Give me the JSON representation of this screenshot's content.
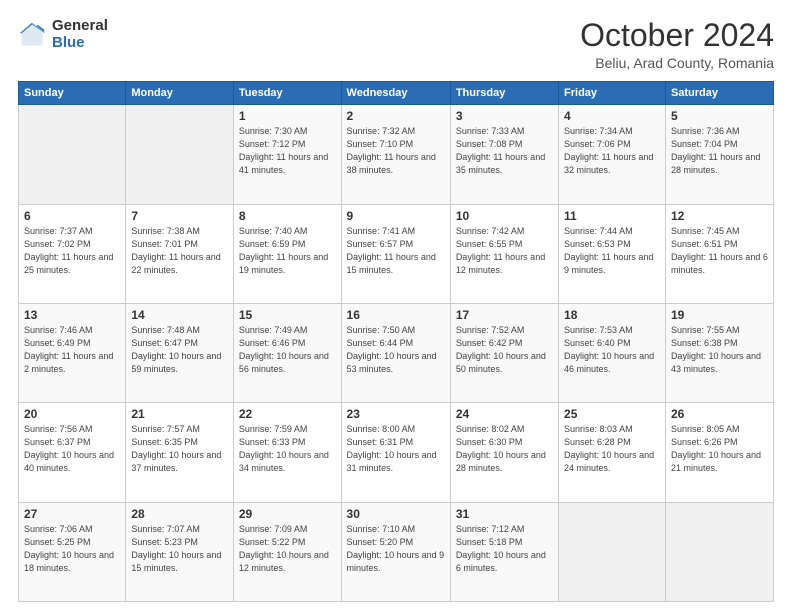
{
  "header": {
    "logo_general": "General",
    "logo_blue": "Blue",
    "title": "October 2024",
    "subtitle": "Beliu, Arad County, Romania"
  },
  "days_of_week": [
    "Sunday",
    "Monday",
    "Tuesday",
    "Wednesday",
    "Thursday",
    "Friday",
    "Saturday"
  ],
  "weeks": [
    [
      {
        "day": "",
        "info": ""
      },
      {
        "day": "",
        "info": ""
      },
      {
        "day": "1",
        "info": "Sunrise: 7:30 AM\nSunset: 7:12 PM\nDaylight: 11 hours and 41 minutes."
      },
      {
        "day": "2",
        "info": "Sunrise: 7:32 AM\nSunset: 7:10 PM\nDaylight: 11 hours and 38 minutes."
      },
      {
        "day": "3",
        "info": "Sunrise: 7:33 AM\nSunset: 7:08 PM\nDaylight: 11 hours and 35 minutes."
      },
      {
        "day": "4",
        "info": "Sunrise: 7:34 AM\nSunset: 7:06 PM\nDaylight: 11 hours and 32 minutes."
      },
      {
        "day": "5",
        "info": "Sunrise: 7:36 AM\nSunset: 7:04 PM\nDaylight: 11 hours and 28 minutes."
      }
    ],
    [
      {
        "day": "6",
        "info": "Sunrise: 7:37 AM\nSunset: 7:02 PM\nDaylight: 11 hours and 25 minutes."
      },
      {
        "day": "7",
        "info": "Sunrise: 7:38 AM\nSunset: 7:01 PM\nDaylight: 11 hours and 22 minutes."
      },
      {
        "day": "8",
        "info": "Sunrise: 7:40 AM\nSunset: 6:59 PM\nDaylight: 11 hours and 19 minutes."
      },
      {
        "day": "9",
        "info": "Sunrise: 7:41 AM\nSunset: 6:57 PM\nDaylight: 11 hours and 15 minutes."
      },
      {
        "day": "10",
        "info": "Sunrise: 7:42 AM\nSunset: 6:55 PM\nDaylight: 11 hours and 12 minutes."
      },
      {
        "day": "11",
        "info": "Sunrise: 7:44 AM\nSunset: 6:53 PM\nDaylight: 11 hours and 9 minutes."
      },
      {
        "day": "12",
        "info": "Sunrise: 7:45 AM\nSunset: 6:51 PM\nDaylight: 11 hours and 6 minutes."
      }
    ],
    [
      {
        "day": "13",
        "info": "Sunrise: 7:46 AM\nSunset: 6:49 PM\nDaylight: 11 hours and 2 minutes."
      },
      {
        "day": "14",
        "info": "Sunrise: 7:48 AM\nSunset: 6:47 PM\nDaylight: 10 hours and 59 minutes."
      },
      {
        "day": "15",
        "info": "Sunrise: 7:49 AM\nSunset: 6:46 PM\nDaylight: 10 hours and 56 minutes."
      },
      {
        "day": "16",
        "info": "Sunrise: 7:50 AM\nSunset: 6:44 PM\nDaylight: 10 hours and 53 minutes."
      },
      {
        "day": "17",
        "info": "Sunrise: 7:52 AM\nSunset: 6:42 PM\nDaylight: 10 hours and 50 minutes."
      },
      {
        "day": "18",
        "info": "Sunrise: 7:53 AM\nSunset: 6:40 PM\nDaylight: 10 hours and 46 minutes."
      },
      {
        "day": "19",
        "info": "Sunrise: 7:55 AM\nSunset: 6:38 PM\nDaylight: 10 hours and 43 minutes."
      }
    ],
    [
      {
        "day": "20",
        "info": "Sunrise: 7:56 AM\nSunset: 6:37 PM\nDaylight: 10 hours and 40 minutes."
      },
      {
        "day": "21",
        "info": "Sunrise: 7:57 AM\nSunset: 6:35 PM\nDaylight: 10 hours and 37 minutes."
      },
      {
        "day": "22",
        "info": "Sunrise: 7:59 AM\nSunset: 6:33 PM\nDaylight: 10 hours and 34 minutes."
      },
      {
        "day": "23",
        "info": "Sunrise: 8:00 AM\nSunset: 6:31 PM\nDaylight: 10 hours and 31 minutes."
      },
      {
        "day": "24",
        "info": "Sunrise: 8:02 AM\nSunset: 6:30 PM\nDaylight: 10 hours and 28 minutes."
      },
      {
        "day": "25",
        "info": "Sunrise: 8:03 AM\nSunset: 6:28 PM\nDaylight: 10 hours and 24 minutes."
      },
      {
        "day": "26",
        "info": "Sunrise: 8:05 AM\nSunset: 6:26 PM\nDaylight: 10 hours and 21 minutes."
      }
    ],
    [
      {
        "day": "27",
        "info": "Sunrise: 7:06 AM\nSunset: 5:25 PM\nDaylight: 10 hours and 18 minutes."
      },
      {
        "day": "28",
        "info": "Sunrise: 7:07 AM\nSunset: 5:23 PM\nDaylight: 10 hours and 15 minutes."
      },
      {
        "day": "29",
        "info": "Sunrise: 7:09 AM\nSunset: 5:22 PM\nDaylight: 10 hours and 12 minutes."
      },
      {
        "day": "30",
        "info": "Sunrise: 7:10 AM\nSunset: 5:20 PM\nDaylight: 10 hours and 9 minutes."
      },
      {
        "day": "31",
        "info": "Sunrise: 7:12 AM\nSunset: 5:18 PM\nDaylight: 10 hours and 6 minutes."
      },
      {
        "day": "",
        "info": ""
      },
      {
        "day": "",
        "info": ""
      }
    ]
  ]
}
